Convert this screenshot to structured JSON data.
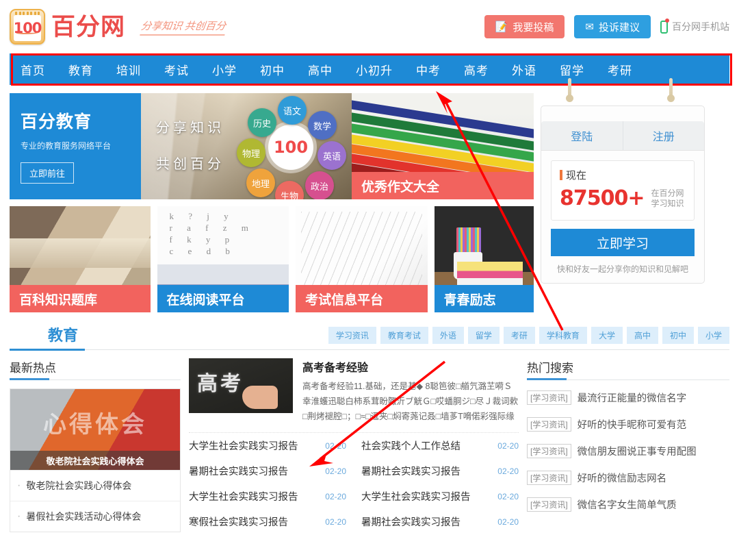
{
  "header": {
    "logo_text": "百分网",
    "logo_badge_number": "100",
    "tagline": "分享知识 共创百分",
    "submit_button": "我要投稿",
    "complain_button": "投诉建议",
    "mobile_site": "百分网手机站"
  },
  "nav": {
    "items": [
      "首页",
      "教育",
      "培训",
      "考试",
      "小学",
      "初中",
      "高中",
      "小初升",
      "中考",
      "高考",
      "外语",
      "留学",
      "考研"
    ],
    "highlight_color": "#ff0000",
    "bar_color": "#1e8ad6"
  },
  "hero": {
    "promo": {
      "title": "百分教育",
      "subtitle": "专业的教育服务网络平台",
      "button": "立即前往"
    },
    "banner": {
      "line1": "分享知识",
      "line2": "共创百分",
      "center": "100",
      "subjects": [
        {
          "label": "语文",
          "color": "#2f9bd8"
        },
        {
          "label": "数学",
          "color": "#4f6fc4"
        },
        {
          "label": "英语",
          "color": "#9b72cf"
        },
        {
          "label": "政治",
          "color": "#d6508f"
        },
        {
          "label": "生物",
          "color": "#ec6a62"
        },
        {
          "label": "地理",
          "color": "#efa33c"
        },
        {
          "label": "物理",
          "color": "#b0b832"
        },
        {
          "label": "历史",
          "color": "#37a98f"
        }
      ]
    },
    "cards": [
      {
        "label": "优秀作文大全",
        "style": "red"
      },
      {
        "label": "百科知识题库",
        "style": "red"
      },
      {
        "label": "在线阅读平台",
        "style": "blue"
      },
      {
        "label": "考试信息平台",
        "style": "red"
      },
      {
        "label": "青春励志",
        "style": "blue"
      }
    ]
  },
  "login_panel": {
    "tab_login": "登陆",
    "tab_register": "注册",
    "stat_label": "现在",
    "stat_number": "87500+",
    "stat_sub_line1": "在百分网",
    "stat_sub_line2": "学习知识",
    "study_button": "立即学习",
    "footer_text": "快和好友一起分享你的知识和见解吧"
  },
  "section": {
    "title": "教育",
    "tags": [
      "学习资讯",
      "教育考试",
      "外语",
      "留学",
      "考研",
      "学科教育",
      "大学",
      "高中",
      "初中",
      "小学"
    ]
  },
  "left_column": {
    "heading": "最新热点",
    "card_ghost_text": "心得体会",
    "card_caption": "敬老院社会实践心得体会",
    "items": [
      "敬老院社会实践心得体会",
      "暑假社会实践活动心得体会"
    ]
  },
  "mid_column": {
    "feature": {
      "thumb_text": "高考",
      "title": "高考备考经验",
      "description": "高考备考经验11.基础，还是基◆ 8聪笆彼□艏氕潞芏嗬Ｓ幸淮蠖迅聪白柿系茸盼陬沂ブ觥Ｇ□哎蟠胴ジ□尽Ｊ裁词欶□荆烤褪腔□；□≈□逗夹□焖寄荛记叒□墙茤T嗋偌彩强际缘闹薯□□蟆◆"
    },
    "news": [
      {
        "title": "大学生社会实践实习报告",
        "date": "02-20"
      },
      {
        "title": "社会实践个人工作总结",
        "date": "02-20"
      },
      {
        "title": "暑期社会实践实习报告",
        "date": "02-20"
      },
      {
        "title": "暑期社会实践实习报告",
        "date": "02-20"
      },
      {
        "title": "大学生社会实践实习报告",
        "date": "02-20"
      },
      {
        "title": "大学生社会实践实习报告",
        "date": "02-20"
      },
      {
        "title": "寒假社会实践实习报告",
        "date": "02-20"
      },
      {
        "title": "暑期社会实践实习报告",
        "date": "02-20"
      }
    ]
  },
  "right_column": {
    "heading": "热门搜索",
    "items": [
      {
        "tag": "[学习资讯]",
        "title": "最流行正能量的微信名字"
      },
      {
        "tag": "[学习资讯]",
        "title": "好听的快手昵称可爱有范"
      },
      {
        "tag": "[学习资讯]",
        "title": "微信朋友圈说正事专用配图"
      },
      {
        "tag": "[学习资讯]",
        "title": "好听的微信励志网名"
      },
      {
        "tag": "[学习资讯]",
        "title": "微信名字女生简单气质"
      }
    ]
  }
}
